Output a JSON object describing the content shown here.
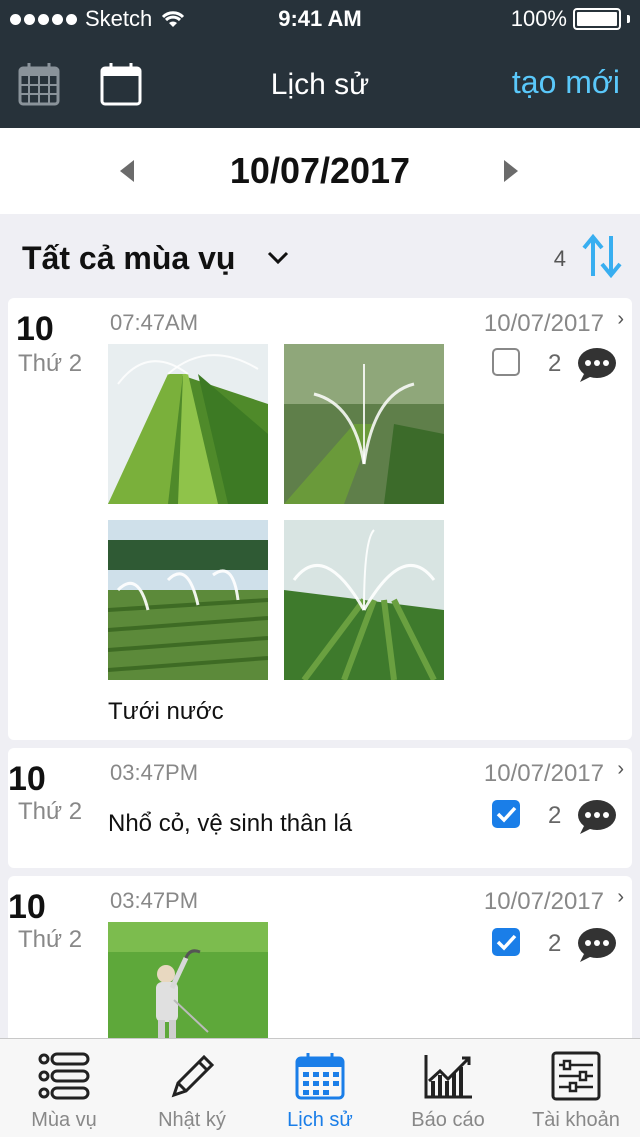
{
  "status_bar": {
    "carrier": "Sketch",
    "time": "9:41 AM",
    "battery": "100%"
  },
  "nav": {
    "title": "Lịch sử",
    "new_label": "tạo mới"
  },
  "date_bar": {
    "date": "10/07/2017"
  },
  "filter": {
    "season": "Tất cả mùa vụ",
    "count": "4"
  },
  "entries": [
    {
      "day": "10",
      "weekday": "Thứ 2",
      "time": "07:47AM",
      "date": "10/07/2017",
      "checked": false,
      "comments": "2",
      "label": "Tưới nước",
      "photos": 4
    },
    {
      "day": "10",
      "weekday": "Thứ 2",
      "time": "03:47PM",
      "date": "10/07/2017",
      "checked": true,
      "comments": "2",
      "label": "Nhổ cỏ, vệ sinh thân lá",
      "photos": 0
    },
    {
      "day": "10",
      "weekday": "Thứ 2",
      "time": "03:47PM",
      "date": "10/07/2017",
      "checked": true,
      "comments": "2",
      "label": "",
      "photos": 1
    }
  ],
  "tabbar": {
    "tabs": [
      {
        "label": "Mùa vụ",
        "icon": "list-icon"
      },
      {
        "label": "Nhật ký",
        "icon": "pencil-icon"
      },
      {
        "label": "Lịch sử",
        "icon": "calendar-icon"
      },
      {
        "label": "Báo cáo",
        "icon": "chart-icon"
      },
      {
        "label": "Tài khoản",
        "icon": "sliders-icon"
      }
    ],
    "active_index": 2
  },
  "colors": {
    "header_bg": "#27323a",
    "accent": "#1a7ee8",
    "link": "#5ac8fa"
  }
}
